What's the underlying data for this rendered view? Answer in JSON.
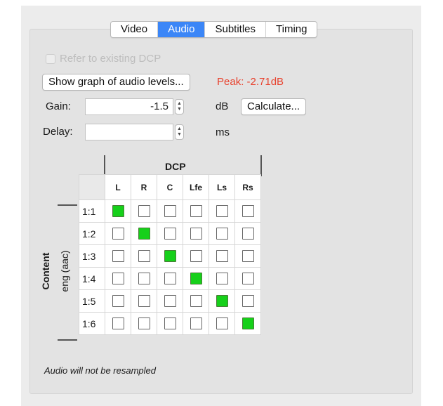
{
  "tabs": [
    "Video",
    "Audio",
    "Subtitles",
    "Timing"
  ],
  "active_tab": "Audio",
  "refer_label": "Refer to existing DCP",
  "graph_button": "Show graph of audio levels...",
  "peak": "Peak: -2.71dB",
  "peak_color": "#e8432f",
  "gain": {
    "label": "Gain:",
    "value": "-1.5",
    "unit": "dB"
  },
  "calculate_button": "Calculate...",
  "delay": {
    "label": "Delay:",
    "value": "",
    "unit": "ms"
  },
  "matrix": {
    "dcp_label": "DCP",
    "content_label": "Content",
    "stream_label": "eng (aac)",
    "columns": [
      "L",
      "R",
      "C",
      "Lfe",
      "Ls",
      "Rs"
    ],
    "rows": [
      {
        "label": "1:1",
        "on": [
          true,
          false,
          false,
          false,
          false,
          false
        ]
      },
      {
        "label": "1:2",
        "on": [
          false,
          true,
          false,
          false,
          false,
          false
        ]
      },
      {
        "label": "1:3",
        "on": [
          false,
          false,
          true,
          false,
          false,
          false
        ]
      },
      {
        "label": "1:4",
        "on": [
          false,
          false,
          false,
          true,
          false,
          false
        ]
      },
      {
        "label": "1:5",
        "on": [
          false,
          false,
          false,
          false,
          true,
          false
        ]
      },
      {
        "label": "1:6",
        "on": [
          false,
          false,
          false,
          false,
          false,
          true
        ]
      }
    ]
  },
  "footer_note": "Audio will not be resampled"
}
